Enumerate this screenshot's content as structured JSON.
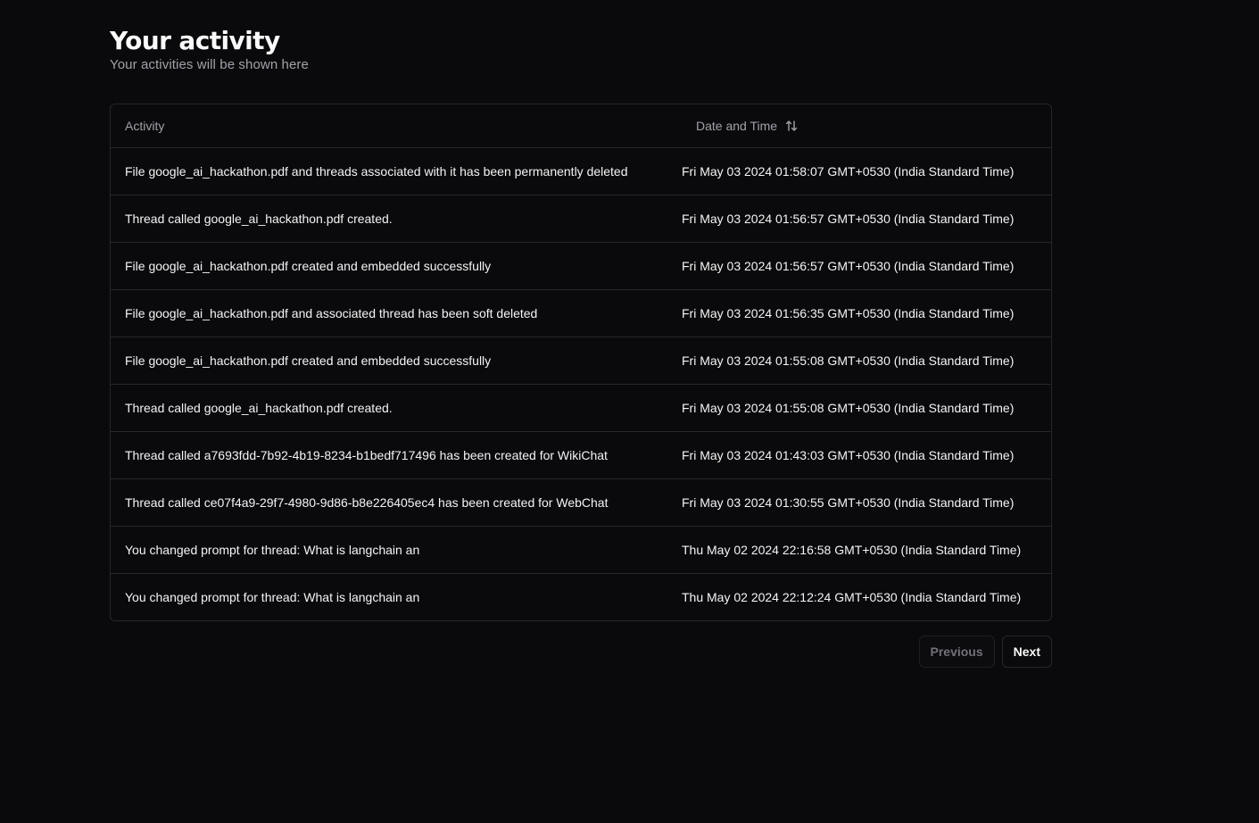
{
  "header": {
    "title": "Your activity",
    "subtitle": "Your activities will be shown here"
  },
  "table": {
    "columns": {
      "activity": "Activity",
      "date": "Date and Time"
    },
    "rows": [
      {
        "activity": "File google_ai_hackathon.pdf and threads associated with it has been permanently deleted",
        "date": "Fri May 03 2024 01:58:07 GMT+0530 (India Standard Time)"
      },
      {
        "activity": "Thread called google_ai_hackathon.pdf created.",
        "date": "Fri May 03 2024 01:56:57 GMT+0530 (India Standard Time)"
      },
      {
        "activity": "File google_ai_hackathon.pdf created and embedded successfully",
        "date": "Fri May 03 2024 01:56:57 GMT+0530 (India Standard Time)"
      },
      {
        "activity": "File google_ai_hackathon.pdf and associated thread has been soft deleted",
        "date": "Fri May 03 2024 01:56:35 GMT+0530 (India Standard Time)"
      },
      {
        "activity": "File google_ai_hackathon.pdf created and embedded successfully",
        "date": "Fri May 03 2024 01:55:08 GMT+0530 (India Standard Time)"
      },
      {
        "activity": "Thread called google_ai_hackathon.pdf created.",
        "date": "Fri May 03 2024 01:55:08 GMT+0530 (India Standard Time)"
      },
      {
        "activity": "Thread called a7693fdd-7b92-4b19-8234-b1bedf717496 has been created for WikiChat",
        "date": "Fri May 03 2024 01:43:03 GMT+0530 (India Standard Time)"
      },
      {
        "activity": "Thread called ce07f4a9-29f7-4980-9d86-b8e226405ec4 has been created for WebChat",
        "date": "Fri May 03 2024 01:30:55 GMT+0530 (India Standard Time)"
      },
      {
        "activity": "You changed prompt for thread: What is langchain an",
        "date": "Thu May 02 2024 22:16:58 GMT+0530 (India Standard Time)"
      },
      {
        "activity": "You changed prompt for thread: What is langchain an",
        "date": "Thu May 02 2024 22:12:24 GMT+0530 (India Standard Time)"
      }
    ]
  },
  "pagination": {
    "previous_label": "Previous",
    "next_label": "Next"
  },
  "icons": {
    "sort": "sort-arrows-icon"
  }
}
